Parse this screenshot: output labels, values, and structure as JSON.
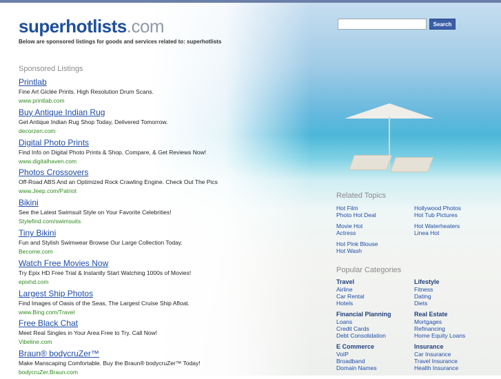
{
  "header": {
    "logo_name": "superhotlists",
    "logo_tld": ".com",
    "tagline": "Below are sponsored listings for goods and services related to: superhotlists"
  },
  "search": {
    "placeholder": "",
    "button_label": "Search"
  },
  "sponsored": {
    "heading": "Sponsored Listings",
    "listings": [
      {
        "title": "Printlab",
        "desc": "Fine Art Giclée Prints. High Resolution Drum Scans.",
        "url": "www.printlab.com"
      },
      {
        "title": "Buy Antique Indian Rug",
        "desc": "Get Antique Indian Rug Shop Today, Delivered Tomorrow.",
        "url": "decorzen.com"
      },
      {
        "title": "Digital Photo Prints",
        "desc": "Find Info on Digital Photo Prints & Shop, Compare, & Get Reviews Now!",
        "url": "www.digitalhaven.com"
      },
      {
        "title": "Photos Crossovers",
        "desc": "Off-Road ABS And an Optimized Rock Crawling Engine. Check Out The Pics",
        "url": "www.Jeep.com/Patriot"
      },
      {
        "title": "Bikini",
        "desc": "See the Latest Swimsuit Style on Your Favorite Celebrities!",
        "url": "Stylefind.com/swimsuits"
      },
      {
        "title": "Tiny Bikini",
        "desc": "Fun and Stylish Swimwear Browse Our Large Collection Today.",
        "url": "Become.com"
      },
      {
        "title": "Watch Free Movies Now",
        "desc": "Try Epix HD Free Trial & Instantly Start Watching 1000s of Movies!",
        "url": "epixhd.com"
      },
      {
        "title": "Largest Ship Photos",
        "desc": "Find Images of Oasis of the Seas, The Largest Cruise Ship Afloat.",
        "url": "www.Bing.com/Travel"
      },
      {
        "title": "Free Black Chat",
        "desc": "Meet Real Singles in Your Area Free to Try. Call Now!",
        "url": "Vibeline.com"
      },
      {
        "title": "Braun® bodycruZer™",
        "desc": "Make Manscaping Comfortable. Buy the Braun® bodycruZer™ Today!",
        "url": "bodycruZer.Braun.com"
      }
    ]
  },
  "related": {
    "heading": "Related Topics",
    "left": [
      "Hot Film",
      "Photo Hot Deal",
      "Movie Hot",
      "Actress",
      "Hot Pink Blouse",
      "Hot Wash"
    ],
    "right": [
      "Hollywood Photos",
      "Hot Tub Pictures",
      "Hot Waterheaters",
      "Linea Hot"
    ]
  },
  "popular": {
    "heading": "Popular Categories",
    "left": [
      {
        "title": "Travel",
        "links": [
          "Airline",
          "Car Rental",
          "Hotels"
        ]
      },
      {
        "title": "Financial Planning",
        "links": [
          "Loans",
          "Credit Cards",
          "Debt Consolidation"
        ]
      },
      {
        "title": "E Commerce",
        "links": [
          "VoIP",
          "Broadband",
          "Domain Names"
        ]
      }
    ],
    "right": [
      {
        "title": "Lifestyle",
        "links": [
          "Fitness",
          "Dating",
          "Diets"
        ]
      },
      {
        "title": "Real Estate",
        "links": [
          "Mortgages",
          "Refinancing",
          "Home Equity Loans"
        ]
      },
      {
        "title": "Insurance",
        "links": [
          "Car Insurance",
          "Travel Insurance",
          "Health Insurance"
        ]
      }
    ]
  }
}
